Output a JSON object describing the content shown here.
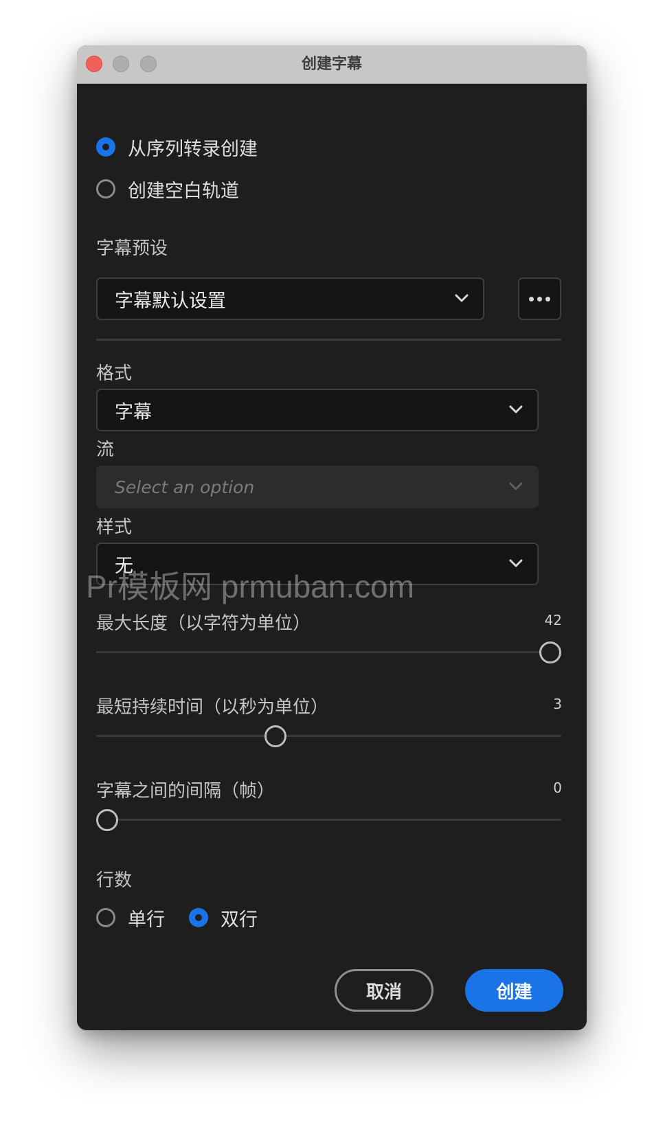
{
  "window": {
    "title": "创建字幕"
  },
  "source": {
    "options": [
      {
        "label": "从序列转录创建",
        "selected": true
      },
      {
        "label": "创建空白轨道",
        "selected": false
      }
    ]
  },
  "preset": {
    "label": "字幕预设",
    "value": "字幕默认设置",
    "more_icon": "ellipsis-icon"
  },
  "format": {
    "label": "格式",
    "value": "字幕"
  },
  "stream": {
    "label": "流",
    "placeholder": "Select an option",
    "disabled": true
  },
  "style": {
    "label": "样式",
    "value": "无"
  },
  "sliders": [
    {
      "label": "最大长度（以字符为单位）",
      "value": "42",
      "fraction": 1.0
    },
    {
      "label": "最短持续时间（以秒为单位）",
      "value": "3",
      "fraction": 0.38
    },
    {
      "label": "字幕之间的间隔（帧）",
      "value": "0",
      "fraction": 0.0
    }
  ],
  "lines": {
    "label": "行数",
    "options": [
      {
        "label": "单行",
        "selected": false
      },
      {
        "label": "双行",
        "selected": true
      }
    ]
  },
  "buttons": {
    "cancel": "取消",
    "create": "创建"
  },
  "watermark": "Pr模板网 prmuban.com",
  "colors": {
    "accent": "#1b73e8",
    "panel": "#1e1e1f",
    "titlebar": "#c8c7c5",
    "close": "#ef6158"
  }
}
